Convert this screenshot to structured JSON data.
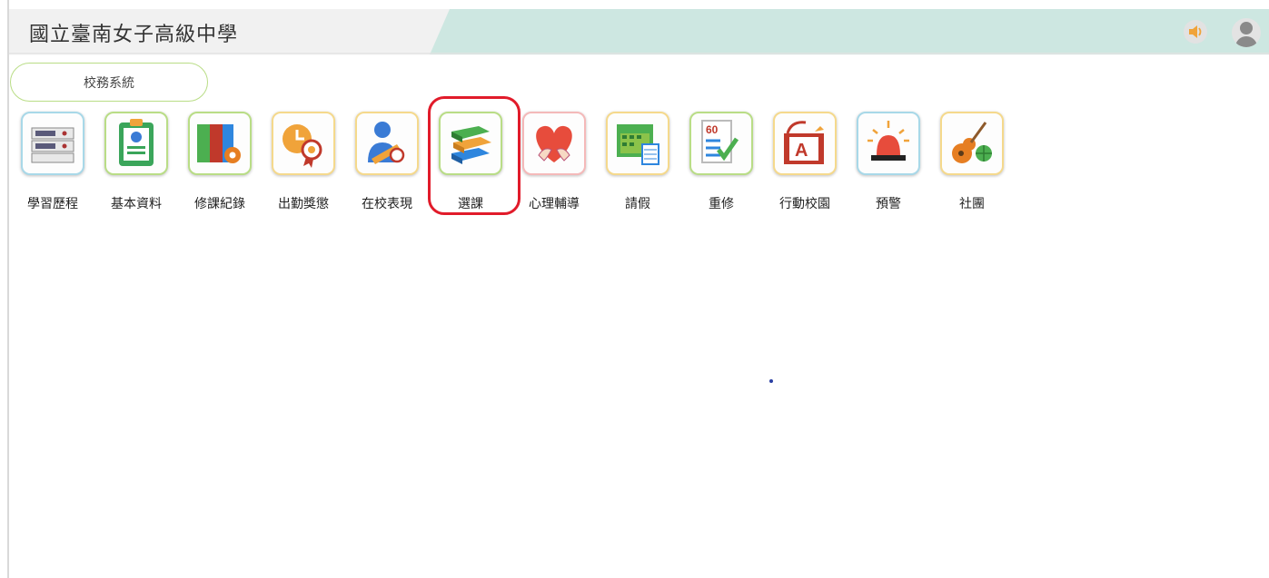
{
  "header": {
    "title": "國立臺南女子高級中學",
    "sound_icon": "speaker-icon",
    "user_icon": "user-avatar-icon",
    "colors": {
      "left_panel": "#f1f1f1",
      "right_panel": "#cde7e1"
    }
  },
  "system_tab": {
    "label": "校務系統",
    "border_color": "#b9dd86"
  },
  "apps": [
    {
      "label": "學習歷程",
      "icon": "archive-boxes-icon",
      "border": "#a8d8e8"
    },
    {
      "label": "基本資料",
      "icon": "id-card-clipboard-icon",
      "border": "#b9dd86"
    },
    {
      "label": "修課紀錄",
      "icon": "binders-gear-icon",
      "border": "#b9dd86"
    },
    {
      "label": "出勤獎懲",
      "icon": "clock-medal-icon",
      "border": "#f5d98c"
    },
    {
      "label": "在校表現",
      "icon": "person-sash-medal-icon",
      "border": "#f5d98c"
    },
    {
      "label": "選課",
      "icon": "book-stack-icon",
      "border": "#b9dd86"
    },
    {
      "label": "心理輔導",
      "icon": "heart-hands-icon",
      "border": "#f4b9b9"
    },
    {
      "label": "請假",
      "icon": "calendar-icon",
      "border": "#f5d98c"
    },
    {
      "label": "重修",
      "icon": "checklist-score-icon",
      "border": "#b9dd86"
    },
    {
      "label": "行動校園",
      "icon": "mobile-campus-icon",
      "border": "#f5d98c"
    },
    {
      "label": "預警",
      "icon": "alarm-siren-icon",
      "border": "#a8d8e8"
    },
    {
      "label": "社團",
      "icon": "guitar-ball-icon",
      "border": "#f5d98c"
    }
  ],
  "highlight": {
    "target": "選課",
    "color": "#e11b2a"
  }
}
